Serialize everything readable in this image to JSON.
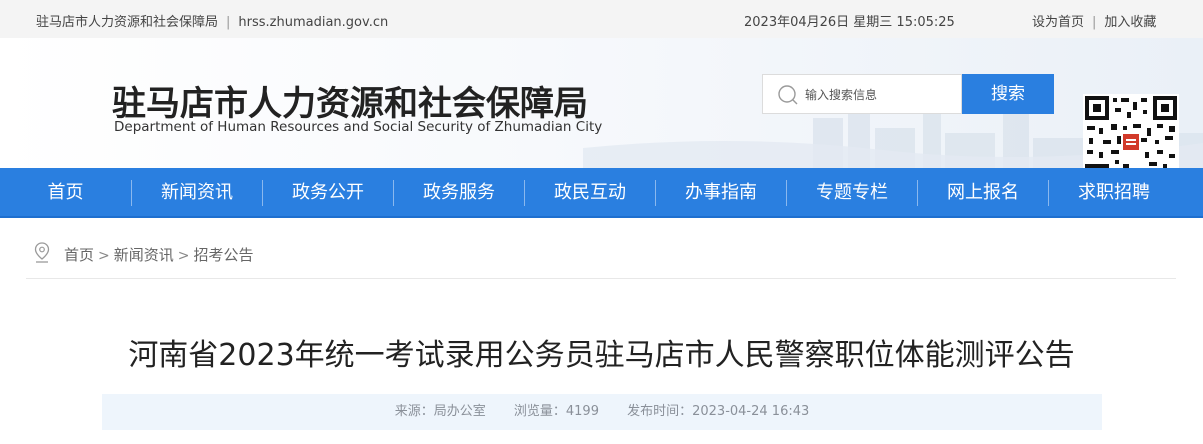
{
  "topbar": {
    "site_name": "驻马店市人力资源和社会保障局",
    "separator": "|",
    "domain": "hrss.zhumadian.gov.cn",
    "datetime": "2023年04月26日 星期三 15:05:25",
    "set_home": "设为首页",
    "link_separator": "|",
    "add_favorite": "加入收藏"
  },
  "header": {
    "title": "驻马店市人力资源和社会保障局",
    "subtitle": "Department of Human Resources and Social Security of Zhumadian City"
  },
  "search": {
    "placeholder": "输入搜索信息",
    "button_label": "搜索"
  },
  "nav": {
    "items": [
      {
        "label": "首页"
      },
      {
        "label": "新闻资讯"
      },
      {
        "label": "政务公开"
      },
      {
        "label": "政务服务"
      },
      {
        "label": "政民互动"
      },
      {
        "label": "办事指南"
      },
      {
        "label": "专题专栏"
      },
      {
        "label": "网上报名"
      },
      {
        "label": "求职招聘"
      }
    ]
  },
  "breadcrumb": {
    "items": [
      "首页",
      "新闻资讯",
      "招考公告"
    ],
    "arrow": ">"
  },
  "article": {
    "title": "河南省2023年统一考试录用公务员驻马店市人民警察职位体能测评公告",
    "source": "来源：局办公室",
    "views": "浏览量：4199",
    "published": "发布时间：2023-04-24 16:43"
  },
  "colors": {
    "accent": "#2a7fe0",
    "topbar_bg": "#f4f4f4",
    "meta_bg": "#eef5fc"
  },
  "icons": {
    "search": "search-icon",
    "location": "location-pin-icon",
    "qr": "qr-code-icon"
  }
}
